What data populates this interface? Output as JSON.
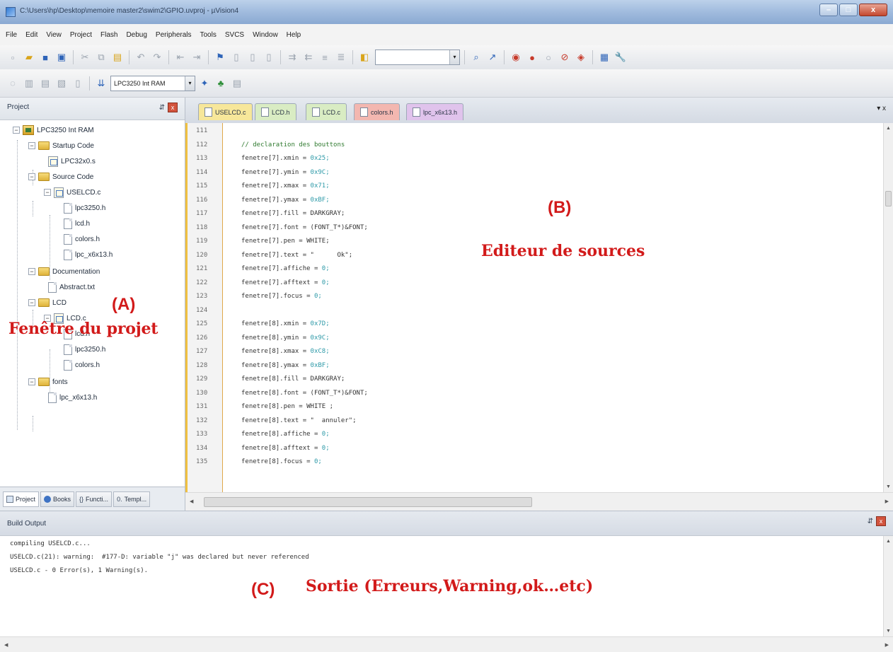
{
  "window": {
    "title": "C:\\Users\\hp\\Desktop\\memoire master2\\swim2\\GPIO.uvproj - µVision4",
    "controls": {
      "minimize": "–",
      "maximize": "□",
      "close": "x"
    }
  },
  "menu": [
    "File",
    "Edit",
    "View",
    "Project",
    "Flash",
    "Debug",
    "Peripherals",
    "Tools",
    "SVCS",
    "Window",
    "Help"
  ],
  "toolbar": {
    "target_select": "LPC3250 Int RAM",
    "dropdown_glyph": "▾"
  },
  "project_panel": {
    "title": "Project",
    "pin_glyph": "⇵",
    "close_glyph": "x",
    "expanded_glyph": "−",
    "tree": {
      "root": "LPC3250 Int RAM",
      "startup_group": "Startup Code",
      "startup_file": "LPC32x0.s",
      "source_group": "Source Code",
      "source_main": "USELCD.c",
      "source_deps": [
        "lpc3250.h",
        "lcd.h",
        "colors.h",
        "lpc_x6x13.h"
      ],
      "doc_group": "Documentation",
      "doc_file": "Abstract.txt",
      "lcd_group": "LCD",
      "lcd_main": "LCD.c",
      "lcd_deps": [
        "lcd.h",
        "lpc3250.h",
        "colors.h"
      ],
      "fonts_group": "fonts",
      "fonts_file": "lpc_x6x13.h"
    },
    "tabs": [
      "Project",
      "Books",
      "Functi...",
      "Templ..."
    ]
  },
  "editor": {
    "tabs": [
      {
        "label": "USELCD.c",
        "color": "#f7e79a"
      },
      {
        "label": "LCD.h",
        "color": "#d9ecc3"
      },
      {
        "label": "LCD.c",
        "color": "#d9ecc3"
      },
      {
        "label": "colors.h",
        "color": "#f3b7b0"
      },
      {
        "label": "lpc_x6x13.h",
        "color": "#e0c3ec"
      }
    ],
    "tab_menu": "▾ x",
    "line_numbers": [
      "111",
      "112",
      "113",
      "114",
      "115",
      "116",
      "117",
      "118",
      "119",
      "120",
      "121",
      "122",
      "123",
      "124",
      "125",
      "126",
      "127",
      "128",
      "129",
      "130",
      "131",
      "132",
      "133",
      "134",
      "135"
    ],
    "code": [
      {
        "text": "",
        "val": ""
      },
      {
        "text": "// declaration des bouttons",
        "val": ""
      },
      {
        "text": "fenetre[7].xmin = ",
        "val": "0x25;"
      },
      {
        "text": "fenetre[7].ymin = ",
        "val": "0x9C;"
      },
      {
        "text": "fenetre[7].xmax = ",
        "val": "0x71;"
      },
      {
        "text": "fenetre[7].ymax = ",
        "val": "0xBF;"
      },
      {
        "text": "fenetre[7].fill = DARKGRAY;",
        "val": ""
      },
      {
        "text": "fenetre[7].font = (FONT_T*)&FONT;",
        "val": ""
      },
      {
        "text": "fenetre[7].pen = WHITE;",
        "val": ""
      },
      {
        "text": "fenetre[7].text = \"      Ok\";",
        "val": ""
      },
      {
        "text": "fenetre[7].affiche = ",
        "val": "0;"
      },
      {
        "text": "fenetre[7].afftext = ",
        "val": "0;"
      },
      {
        "text": "fenetre[7].focus = ",
        "val": "0;"
      },
      {
        "text": "",
        "val": ""
      },
      {
        "text": "fenetre[8].xmin = ",
        "val": "0x7D;"
      },
      {
        "text": "fenetre[8].ymin = ",
        "val": "0x9C;"
      },
      {
        "text": "fenetre[8].xmax = ",
        "val": "0xC8;"
      },
      {
        "text": "fenetre[8].ymax = ",
        "val": "0xBF;"
      },
      {
        "text": "fenetre[8].fill = DARKGRAY;",
        "val": ""
      },
      {
        "text": "fenetre[8].font = (FONT_T*)&FONT;",
        "val": ""
      },
      {
        "text": "fenetre[8].pen = WHITE ;",
        "val": ""
      },
      {
        "text": "fenetre[8].text = \"  annuler\";",
        "val": ""
      },
      {
        "text": "fenetre[8].affiche = ",
        "val": "0;"
      },
      {
        "text": "fenetre[8].afftext = ",
        "val": "0;"
      },
      {
        "text": "fenetre[8].focus = ",
        "val": "0;"
      }
    ]
  },
  "build_output": {
    "title": "Build Output",
    "lines": [
      "compiling USELCD.c...",
      "USELCD.c(21): warning:  #177-D: variable \"j\" was declared but never referenced",
      "USELCD.c - 0 Error(s), 1 Warning(s)."
    ]
  },
  "annotations": {
    "a_label": "(A)",
    "a_text": "Fenêtre du projet",
    "b_label": "(B)",
    "b_text": "Editeur de sources",
    "c_label": "(C)",
    "c_text": "Sortie (Erreurs,Warning,ok…etc)",
    "color": "#d21a1a"
  }
}
